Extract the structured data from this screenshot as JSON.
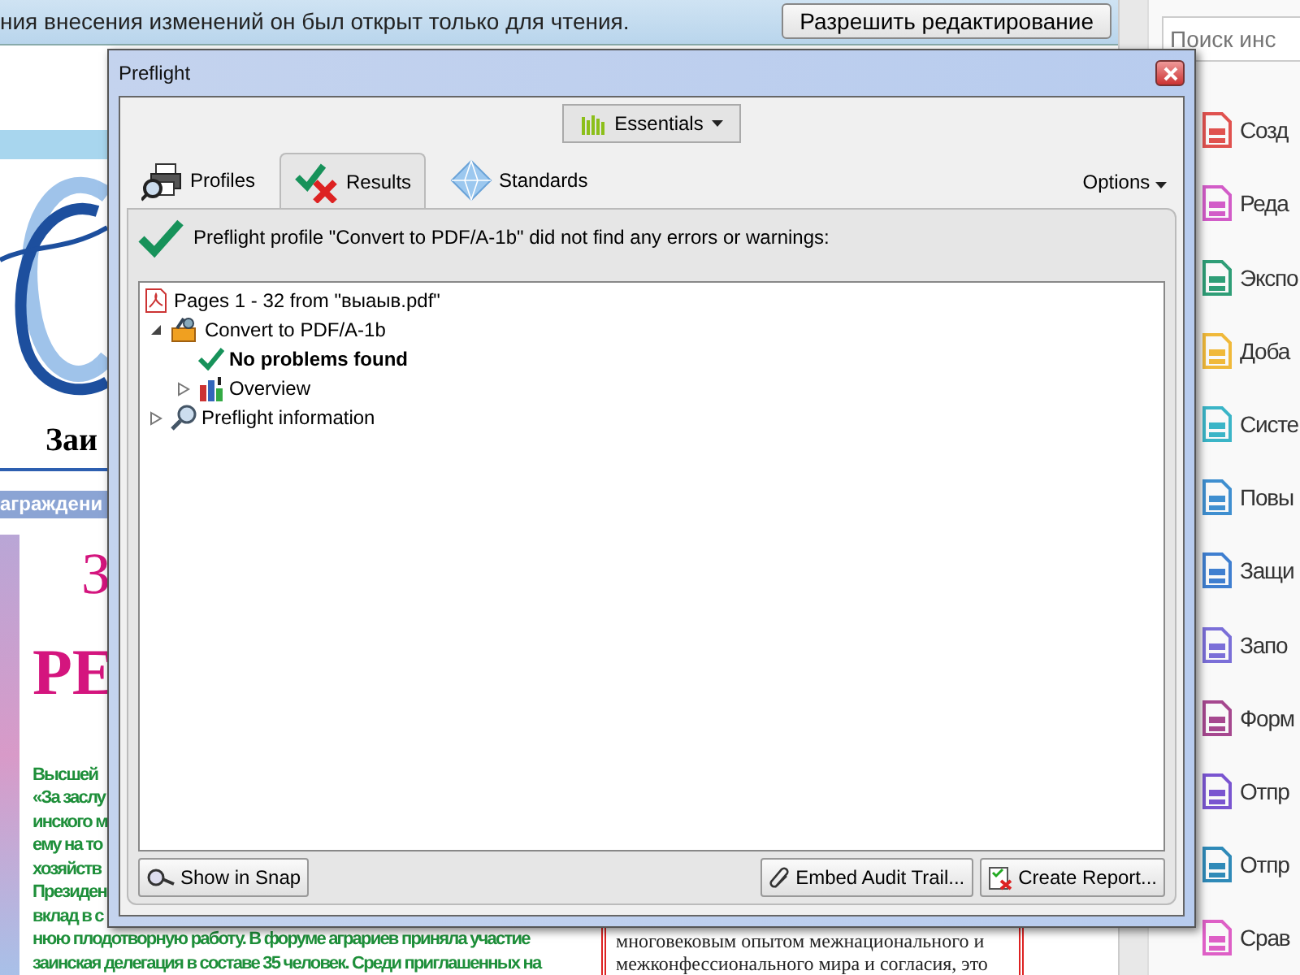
{
  "info_bar": {
    "message": "ния внесения изменений он был открыт только для чтения.",
    "button": "Разрешить редактирование"
  },
  "document": {
    "masthead": "Заи",
    "banner": "аграждени",
    "headline_1": "З",
    "headline_2": "РЕ",
    "column_lines": [
      "Высшей",
      "«За заслу",
      "инского м",
      "ему на то",
      "хозяйств",
      "Президен",
      "вклад в с",
      "нюю плодотворную работу. В форуме аграриев приняла участие",
      "заинская делегация в составе 35 человек. Среди приглашенных на"
    ],
    "box_lines": [
      "многовековым опытом межнационального и",
      "межконфессионального мира и согласия, это"
    ]
  },
  "preflight": {
    "title": "Preflight",
    "profile_menu": "Essentials",
    "tabs": [
      {
        "label": "Profiles",
        "kind": "profiles",
        "selected": false
      },
      {
        "label": "Results",
        "kind": "results",
        "selected": true
      },
      {
        "label": "Standards",
        "kind": "standards",
        "selected": false
      }
    ],
    "options": "Options",
    "message": "Preflight profile \"Convert to PDF/A-1b\" did not find any errors or warnings:",
    "tree": [
      {
        "label": "Pages 1 - 32 from \"выаыв.pdf\"",
        "kind": "pdf",
        "children": [
          {
            "label": "Convert to PDF/A-1b",
            "kind": "fixup",
            "expanded": true,
            "children": [
              {
                "label": "No problems found",
                "kind": "result"
              },
              {
                "label": "Overview",
                "kind": "chart",
                "expanded": false
              }
            ]
          },
          {
            "label": "Preflight information",
            "kind": "info",
            "expanded": false
          }
        ]
      }
    ],
    "left_button": "Show in Snap",
    "right_buttons": [
      {
        "label": "Embed Audit Trail...",
        "kind": "clip"
      },
      {
        "label": "Create Report...",
        "kind": "report"
      }
    ]
  },
  "tools": {
    "search": {
      "placeholder": "Поиск инс"
    },
    "items": [
      {
        "label": "Созд",
        "color": "#e0524f"
      },
      {
        "label": "Реда",
        "color": "#d25cc8"
      },
      {
        "label": "Экспо",
        "color": "#2f9e77"
      },
      {
        "label": "Доба",
        "color": "#f0b93a"
      },
      {
        "label": "Систе",
        "color": "#3bb5c7"
      },
      {
        "label": "Повы",
        "color": "#3f8fd0"
      },
      {
        "label": "Защи",
        "color": "#3f7fd0"
      },
      {
        "label": "Запо",
        "color": "#7b6fd8"
      },
      {
        "label": "Форм",
        "color": "#a6488f"
      },
      {
        "label": "Отпр",
        "color": "#7a55d0"
      },
      {
        "label": "Отпр",
        "color": "#2f8ab8"
      },
      {
        "label": "Срав",
        "color": "#de5fc6"
      }
    ]
  }
}
